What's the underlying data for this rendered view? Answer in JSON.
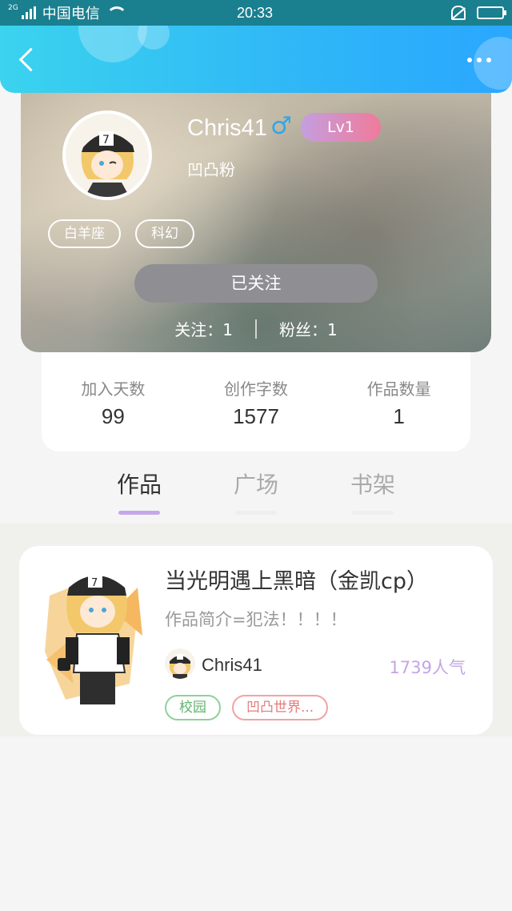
{
  "status_bar": {
    "network_tag": "2G",
    "carrier": "中国电信",
    "time": "20:33"
  },
  "profile": {
    "username": "Chris41",
    "gender_symbol": "♂",
    "level": "Lv1",
    "subtitle": "凹凸粉",
    "tags": [
      "白羊座",
      "科幻"
    ],
    "follow_button": "已关注",
    "following_label": "关注：1",
    "followers_label": "粉丝：1"
  },
  "stats": [
    {
      "label": "加入天数",
      "value": "99"
    },
    {
      "label": "创作字数",
      "value": "1577"
    },
    {
      "label": "作品数量",
      "value": "1"
    }
  ],
  "tabs": [
    {
      "label": "作品",
      "active": true
    },
    {
      "label": "广场",
      "active": false
    },
    {
      "label": "书架",
      "active": false
    }
  ],
  "work": {
    "title": "当光明遇上黑暗（金凯cp）",
    "description": "作品简介=犯法！！！！",
    "author": "Chris41",
    "popularity": "1739人气",
    "tags": [
      "校园",
      "凹凸世界..."
    ]
  },
  "colors": {
    "header_start": "#3bd3ee",
    "header_end": "#2aa7ff",
    "accent_purple": "#c6a7ea",
    "gender_blue": "#2fa7e8",
    "tag_green": "#5fb46b",
    "tag_red": "#e47b7b"
  },
  "icons": [
    "back-arrow-icon",
    "more-dots-icon",
    "signal-icon",
    "wifi-icon",
    "mute-bell-icon",
    "battery-icon"
  ]
}
